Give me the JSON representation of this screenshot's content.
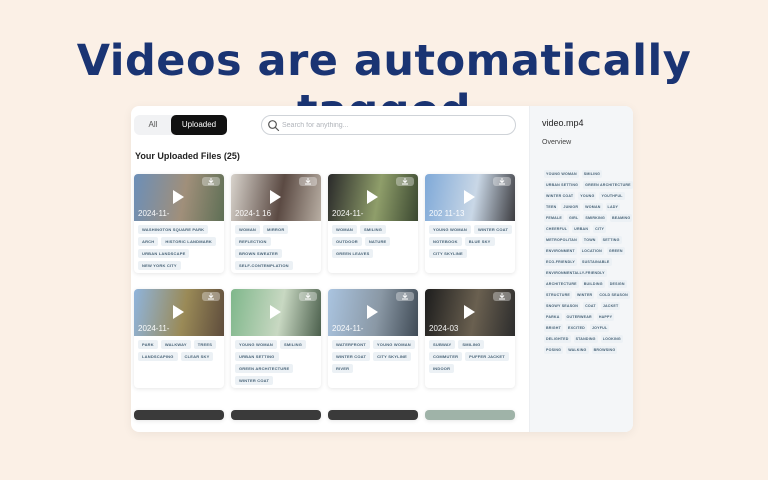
{
  "headline": "Videos are automatically tagged",
  "tabs": {
    "all": "All",
    "uploaded": "Uploaded"
  },
  "search": {
    "placeholder": "Search for anything...",
    "value": ""
  },
  "files_title": "Your Uploaded Files (25)",
  "cards": [
    {
      "date": "2024-11-",
      "tags": [
        "WASHINGTON SQUARE PARK",
        "ARCH",
        "HISTORIC LANDMARK",
        "URBAN LANDSCAPE",
        "NEW YORK CITY"
      ]
    },
    {
      "date": "2024-1  16",
      "tags": [
        "WOMAN",
        "MIRROR",
        "REFLECTION",
        "BROWN SWEATER",
        "SELF-CONTEMPLATION"
      ]
    },
    {
      "date": "2024-11-",
      "tags": [
        "WOMAN",
        "SMILING",
        "OUTDOOR",
        "NATURE",
        "GREEN LEAVES"
      ]
    },
    {
      "date": "202  11-13",
      "tags": [
        "YOUNG WOMAN",
        "WINTER COAT",
        "NOTEBOOK",
        "BLUE SKY",
        "CITY SKYLINE"
      ]
    },
    {
      "date": "2024-11-",
      "tags": [
        "PARK",
        "WALKWAY",
        "TREES",
        "LANDSCAPING",
        "CLEAR SKY"
      ]
    },
    {
      "date": "",
      "tags": [
        "YOUNG WOMAN",
        "SMILING",
        "URBAN SETTING",
        "GREEN ARCHITECTURE",
        "WINTER COAT"
      ]
    },
    {
      "date": "2024-11-",
      "tags": [
        "WATERFRONT",
        "YOUNG WOMAN",
        "WINTER COAT",
        "CITY SKYLINE",
        "RIVER"
      ]
    },
    {
      "date": "2024-03",
      "tags": [
        "SUBWAY",
        "SMILING",
        "COMMUTER",
        "PUFFER JACKET",
        "INDOOR"
      ]
    }
  ],
  "sidebar": {
    "title": "video.mp4",
    "overview": "Overview",
    "tags": [
      "YOUNG WOMAN",
      "SMILING",
      "URBAN SETTING",
      "GREEN ARCHITECTURE",
      "WINTER COAT",
      "YOUNG",
      "YOUTHFUL",
      "TEEN",
      "JUNIOR",
      "WOMAN",
      "LADY",
      "FEMALE",
      "GIRL",
      "SMIRKING",
      "BEAMING",
      "CHEERFUL",
      "URBAN",
      "CITY",
      "METROPOLITAN",
      "TOWN",
      "SETTING",
      "ENVIRONMENT",
      "LOCATION",
      "GREEN",
      "ECO-FRIENDLY",
      "SUSTAINABLE",
      "ENVIRONMENTALLY-FRIENDLY",
      "ARCHITECTURE",
      "BUILDING",
      "DESIGN",
      "STRUCTURE",
      "WINTER",
      "COLD SEASON",
      "SNOWY SEASON",
      "COAT",
      "JACKET",
      "PARKA",
      "OUTERWEAR",
      "HAPPY",
      "BRIGHT",
      "EXCITED",
      "JOYFUL",
      "DELIGHTED",
      "STANDING",
      "LOOKING",
      "POSING",
      "WALKING",
      "BROWSING"
    ]
  },
  "colors": {
    "headline": "#1a3473",
    "background": "#fbf0e6",
    "tab_active": "#111111",
    "tag_bg": "#ecf1f5",
    "tag_text": "#476276"
  },
  "thumbs": [
    [
      "#6c8fb8",
      "#a08f7a",
      "#5e6f55"
    ],
    [
      "#d8d3cc",
      "#5b4a43",
      "#b8aea3"
    ],
    [
      "#2a2a2a",
      "#8f9e6a",
      "#3a4730"
    ],
    [
      "#7fa9d8",
      "#c9d7e6",
      "#3c3c40"
    ],
    [
      "#8fb4dc",
      "#9a8a57",
      "#5e4c3c"
    ],
    [
      "#7fb78b",
      "#c8d8c2",
      "#4b5f4c"
    ],
    [
      "#aac4e0",
      "#8a98a5",
      "#3f4a55"
    ],
    [
      "#1d1d1d",
      "#6a6050",
      "#2c2c2c"
    ]
  ]
}
